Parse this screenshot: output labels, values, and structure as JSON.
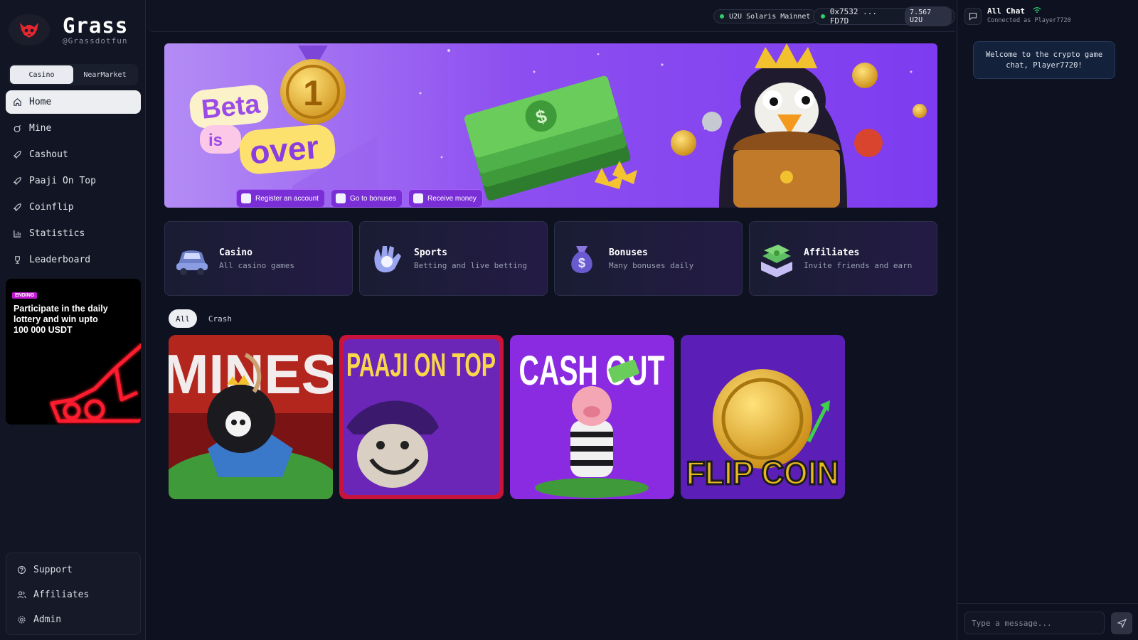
{
  "brand": {
    "name": "Grass",
    "handle": "@Grassdotfun",
    "logo_icon": "fox-icon"
  },
  "mode_toggle": {
    "options": [
      "Casino",
      "NearMarket"
    ],
    "selected": "Casino"
  },
  "nav": {
    "items": [
      {
        "label": "Home",
        "icon": "home-icon",
        "active": true
      },
      {
        "label": "Mine",
        "icon": "mine-icon"
      },
      {
        "label": "Cashout",
        "icon": "rocket-icon"
      },
      {
        "label": "Paaji On Top",
        "icon": "rocket-icon"
      },
      {
        "label": "Coinflip",
        "icon": "rocket-icon"
      },
      {
        "label": "Statistics",
        "icon": "chart-icon"
      },
      {
        "label": "Leaderboard",
        "icon": "trophy-icon"
      }
    ]
  },
  "promo": {
    "badge": "ENDING",
    "text": "Participate in the daily lottery and win upto 100 000 USDT"
  },
  "footer_nav": {
    "items": [
      {
        "label": "Support",
        "icon": "help-icon"
      },
      {
        "label": "Affiliates",
        "icon": "users-icon"
      },
      {
        "label": "Admin",
        "icon": "gear-icon"
      }
    ]
  },
  "topbar": {
    "network": "U2U Solaris Mainnet",
    "wallet_address": "0x7532 ... FD7D",
    "wallet_balance": "7.567 U2U"
  },
  "banner": {
    "headline": [
      "Beta",
      "is",
      "over"
    ],
    "medal_number": "1",
    "actions": [
      "Register an account",
      "Go to bonuses",
      "Receive money"
    ]
  },
  "categories": [
    {
      "title": "Casino",
      "subtitle": "All casino games",
      "icon": "car-icon"
    },
    {
      "title": "Sports",
      "subtitle": "Betting and live betting",
      "icon": "glove-icon"
    },
    {
      "title": "Bonuses",
      "subtitle": "Many bonuses daily",
      "icon": "money-bag-icon"
    },
    {
      "title": "Affiliates",
      "subtitle": "Invite friends and earn",
      "icon": "cash-stack-icon"
    }
  ],
  "filter_tabs": {
    "items": [
      "All",
      "Crash"
    ],
    "selected": "All"
  },
  "games": [
    {
      "name": "MINES",
      "key": "mines"
    },
    {
      "name": "PAAJI ON TOP",
      "key": "paaji"
    },
    {
      "name": "CASH OUT",
      "key": "cashout"
    },
    {
      "name": "FLIP COIN",
      "key": "flip"
    }
  ],
  "chat": {
    "title": "All Chat",
    "subtitle": "Connected as Player7720",
    "welcome": "Welcome to the crypto game chat, Player7720!",
    "input_placeholder": "Type a message..."
  },
  "colors": {
    "accent": "#7a2fd6",
    "online": "#2ecf6a",
    "background": "#0e1220"
  }
}
